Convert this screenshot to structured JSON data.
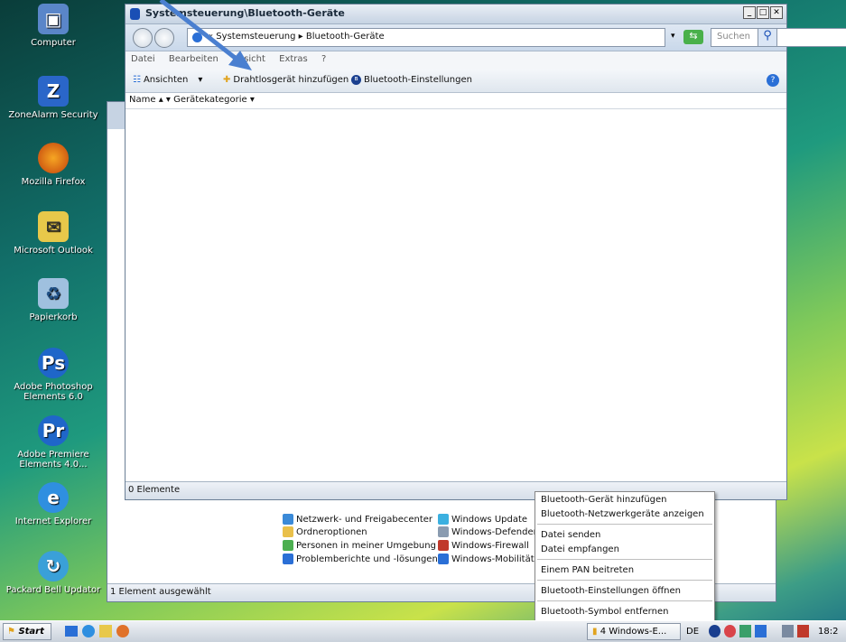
{
  "desktop": {
    "icons": [
      {
        "label": "Computer"
      },
      {
        "label": "ZoneAlarm Security"
      },
      {
        "label": "Mozilla Firefox"
      },
      {
        "label": "Microsoft Outlook"
      },
      {
        "label": "Papierkorb"
      },
      {
        "label": "Adobe Photoshop Elements 6.0"
      },
      {
        "label": "Adobe Premiere Elements 4.0..."
      },
      {
        "label": "Internet Explorer"
      },
      {
        "label": "Packard Bell Updator"
      }
    ]
  },
  "window": {
    "title": "Systemsteuerung\\Bluetooth-Geräte",
    "address": "« Systemsteuerung ▸ Bluetooth-Geräte",
    "search_placeholder": "Suchen",
    "menu": [
      "Datei",
      "Bearbeiten",
      "Ansicht",
      "Extras",
      "?"
    ],
    "toolbar": {
      "views": "Ansichten",
      "add_wireless": "Drahtlosgerät hinzufügen",
      "bt_settings": "Bluetooth-Einstellungen"
    },
    "columns": [
      "Name",
      "Gerätekategorie"
    ],
    "status": "0 Elemente"
  },
  "back_window": {
    "status": "1 Element ausgewählt",
    "items_col1": [
      "Netzwerk- und Freigabecenter",
      "Ordneroptionen",
      "Personen in meiner Umgebung",
      "Problemberichte und -lösungen"
    ],
    "items_col2": [
      "Windows Update",
      "Windows-Defender",
      "Windows-Firewall",
      "Windows-Mobilitätsce"
    ]
  },
  "context_menu": {
    "groups": [
      [
        "Bluetooth-Gerät hinzufügen",
        "Bluetooth-Netzwerkgeräte anzeigen"
      ],
      [
        "Datei senden",
        "Datei empfangen"
      ],
      [
        "Einem PAN beitreten"
      ],
      [
        "Bluetooth-Einstellungen öffnen"
      ],
      [
        "Bluetooth-Symbol entfernen"
      ]
    ]
  },
  "taskbar": {
    "start": "Start",
    "task_group": "4 Windows-E...",
    "lang": "DE",
    "clock": "18:2"
  },
  "colors": {
    "accent": "#2a6fd6",
    "arrow": "#4a7fd0"
  }
}
